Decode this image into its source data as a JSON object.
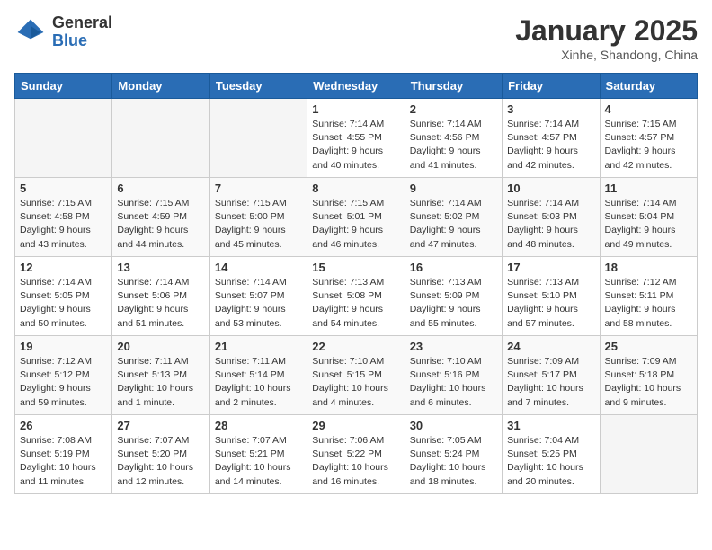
{
  "header": {
    "logo_general": "General",
    "logo_blue": "Blue",
    "month_title": "January 2025",
    "location": "Xinhe, Shandong, China"
  },
  "days_of_week": [
    "Sunday",
    "Monday",
    "Tuesday",
    "Wednesday",
    "Thursday",
    "Friday",
    "Saturday"
  ],
  "weeks": [
    [
      {
        "day": "",
        "info": ""
      },
      {
        "day": "",
        "info": ""
      },
      {
        "day": "",
        "info": ""
      },
      {
        "day": "1",
        "info": "Sunrise: 7:14 AM\nSunset: 4:55 PM\nDaylight: 9 hours\nand 40 minutes."
      },
      {
        "day": "2",
        "info": "Sunrise: 7:14 AM\nSunset: 4:56 PM\nDaylight: 9 hours\nand 41 minutes."
      },
      {
        "day": "3",
        "info": "Sunrise: 7:14 AM\nSunset: 4:57 PM\nDaylight: 9 hours\nand 42 minutes."
      },
      {
        "day": "4",
        "info": "Sunrise: 7:15 AM\nSunset: 4:57 PM\nDaylight: 9 hours\nand 42 minutes."
      }
    ],
    [
      {
        "day": "5",
        "info": "Sunrise: 7:15 AM\nSunset: 4:58 PM\nDaylight: 9 hours\nand 43 minutes."
      },
      {
        "day": "6",
        "info": "Sunrise: 7:15 AM\nSunset: 4:59 PM\nDaylight: 9 hours\nand 44 minutes."
      },
      {
        "day": "7",
        "info": "Sunrise: 7:15 AM\nSunset: 5:00 PM\nDaylight: 9 hours\nand 45 minutes."
      },
      {
        "day": "8",
        "info": "Sunrise: 7:15 AM\nSunset: 5:01 PM\nDaylight: 9 hours\nand 46 minutes."
      },
      {
        "day": "9",
        "info": "Sunrise: 7:14 AM\nSunset: 5:02 PM\nDaylight: 9 hours\nand 47 minutes."
      },
      {
        "day": "10",
        "info": "Sunrise: 7:14 AM\nSunset: 5:03 PM\nDaylight: 9 hours\nand 48 minutes."
      },
      {
        "day": "11",
        "info": "Sunrise: 7:14 AM\nSunset: 5:04 PM\nDaylight: 9 hours\nand 49 minutes."
      }
    ],
    [
      {
        "day": "12",
        "info": "Sunrise: 7:14 AM\nSunset: 5:05 PM\nDaylight: 9 hours\nand 50 minutes."
      },
      {
        "day": "13",
        "info": "Sunrise: 7:14 AM\nSunset: 5:06 PM\nDaylight: 9 hours\nand 51 minutes."
      },
      {
        "day": "14",
        "info": "Sunrise: 7:14 AM\nSunset: 5:07 PM\nDaylight: 9 hours\nand 53 minutes."
      },
      {
        "day": "15",
        "info": "Sunrise: 7:13 AM\nSunset: 5:08 PM\nDaylight: 9 hours\nand 54 minutes."
      },
      {
        "day": "16",
        "info": "Sunrise: 7:13 AM\nSunset: 5:09 PM\nDaylight: 9 hours\nand 55 minutes."
      },
      {
        "day": "17",
        "info": "Sunrise: 7:13 AM\nSunset: 5:10 PM\nDaylight: 9 hours\nand 57 minutes."
      },
      {
        "day": "18",
        "info": "Sunrise: 7:12 AM\nSunset: 5:11 PM\nDaylight: 9 hours\nand 58 minutes."
      }
    ],
    [
      {
        "day": "19",
        "info": "Sunrise: 7:12 AM\nSunset: 5:12 PM\nDaylight: 9 hours\nand 59 minutes."
      },
      {
        "day": "20",
        "info": "Sunrise: 7:11 AM\nSunset: 5:13 PM\nDaylight: 10 hours\nand 1 minute."
      },
      {
        "day": "21",
        "info": "Sunrise: 7:11 AM\nSunset: 5:14 PM\nDaylight: 10 hours\nand 2 minutes."
      },
      {
        "day": "22",
        "info": "Sunrise: 7:10 AM\nSunset: 5:15 PM\nDaylight: 10 hours\nand 4 minutes."
      },
      {
        "day": "23",
        "info": "Sunrise: 7:10 AM\nSunset: 5:16 PM\nDaylight: 10 hours\nand 6 minutes."
      },
      {
        "day": "24",
        "info": "Sunrise: 7:09 AM\nSunset: 5:17 PM\nDaylight: 10 hours\nand 7 minutes."
      },
      {
        "day": "25",
        "info": "Sunrise: 7:09 AM\nSunset: 5:18 PM\nDaylight: 10 hours\nand 9 minutes."
      }
    ],
    [
      {
        "day": "26",
        "info": "Sunrise: 7:08 AM\nSunset: 5:19 PM\nDaylight: 10 hours\nand 11 minutes."
      },
      {
        "day": "27",
        "info": "Sunrise: 7:07 AM\nSunset: 5:20 PM\nDaylight: 10 hours\nand 12 minutes."
      },
      {
        "day": "28",
        "info": "Sunrise: 7:07 AM\nSunset: 5:21 PM\nDaylight: 10 hours\nand 14 minutes."
      },
      {
        "day": "29",
        "info": "Sunrise: 7:06 AM\nSunset: 5:22 PM\nDaylight: 10 hours\nand 16 minutes."
      },
      {
        "day": "30",
        "info": "Sunrise: 7:05 AM\nSunset: 5:24 PM\nDaylight: 10 hours\nand 18 minutes."
      },
      {
        "day": "31",
        "info": "Sunrise: 7:04 AM\nSunset: 5:25 PM\nDaylight: 10 hours\nand 20 minutes."
      },
      {
        "day": "",
        "info": ""
      }
    ]
  ]
}
